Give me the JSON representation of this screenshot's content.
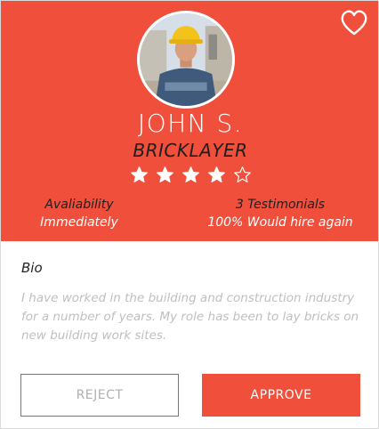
{
  "colors": {
    "accent": "#ef4f3b",
    "text_dark": "#1f1f1f",
    "muted": "#bfbfbf"
  },
  "profile": {
    "name": "JOHN S.",
    "role": "BRICKLAYER",
    "rating": 4,
    "rating_max": 5
  },
  "stats": {
    "availability_label": "Avaliability",
    "availability_value": "Immediately",
    "testimonials_label": "3 Testimonials",
    "hire_again_value": "100% Would hire again"
  },
  "bio": {
    "title": "Bio",
    "text": "I have worked in the building and construction industry for a number of years. My role has been to lay bricks on new building work sites."
  },
  "actions": {
    "reject_label": "REJECT",
    "approve_label": "APPROVE"
  },
  "icons": {
    "favorite": "heart-outline-icon",
    "star_filled": "star-filled-icon",
    "star_empty": "star-outline-icon"
  }
}
